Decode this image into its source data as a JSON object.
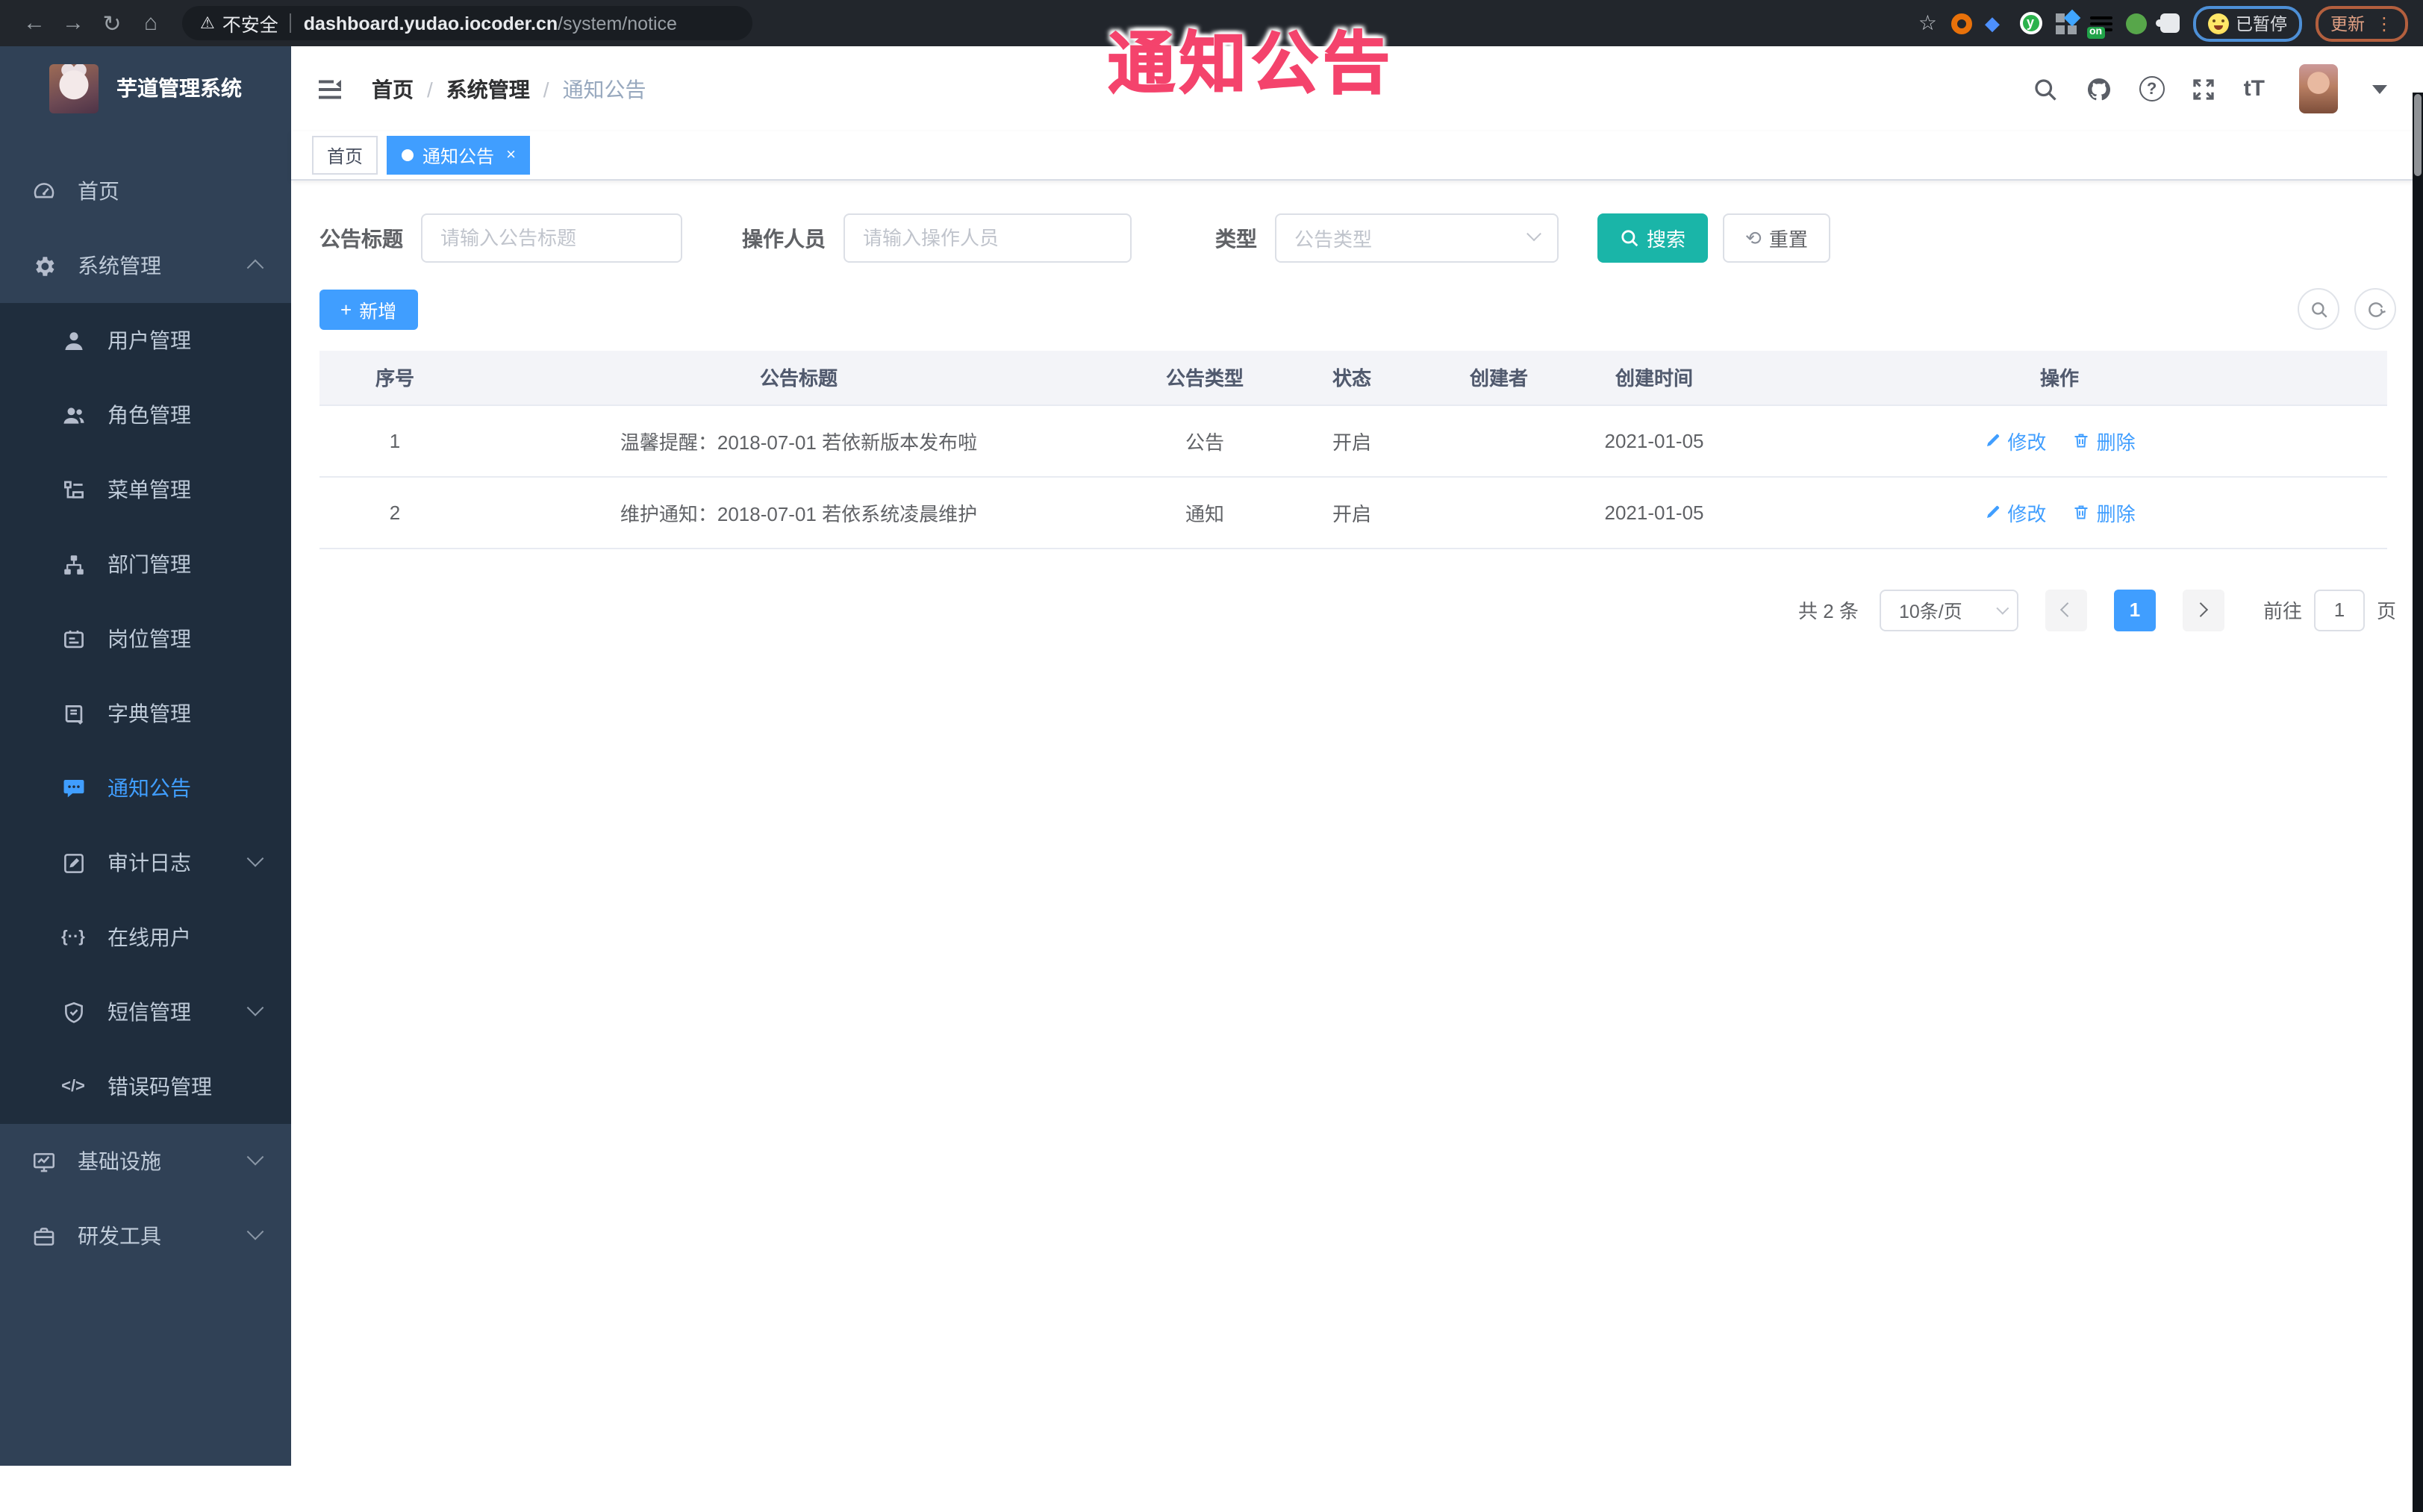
{
  "overlay": {
    "title": "通知公告"
  },
  "browser": {
    "security_label": "不安全",
    "url_host": "dashboard.yudao.iocoder.cn",
    "url_path": "/system/notice",
    "on_badge": "on",
    "paused_label": "已暂停",
    "update_label": "更新"
  },
  "sidebar": {
    "app_title": "芋道管理系统",
    "items": [
      {
        "label": "首页",
        "icon": "dashboard"
      },
      {
        "label": "系统管理",
        "icon": "gear",
        "chevron": "up"
      },
      {
        "label": "用户管理",
        "icon": "user",
        "sub": true
      },
      {
        "label": "角色管理",
        "icon": "users",
        "sub": true
      },
      {
        "label": "菜单管理",
        "icon": "menu-tree",
        "sub": true
      },
      {
        "label": "部门管理",
        "icon": "org-tree",
        "sub": true
      },
      {
        "label": "岗位管理",
        "icon": "id-badge",
        "sub": true
      },
      {
        "label": "字典管理",
        "icon": "dictionary",
        "sub": true
      },
      {
        "label": "通知公告",
        "icon": "announcement",
        "sub": true,
        "active": true
      },
      {
        "label": "审计日志",
        "icon": "audit-log",
        "sub": true,
        "chevron": "down"
      },
      {
        "label": "在线用户",
        "icon": "online-user",
        "sub": true
      },
      {
        "label": "短信管理",
        "icon": "sms-shield",
        "sub": true,
        "chevron": "down"
      },
      {
        "label": "错误码管理",
        "icon": "error-code",
        "sub": true
      },
      {
        "label": "基础设施",
        "icon": "infrastructure",
        "chevron": "down"
      },
      {
        "label": "研发工具",
        "icon": "dev-tools",
        "chevron": "down"
      }
    ]
  },
  "header": {
    "breadcrumb": [
      "首页",
      "系统管理",
      "通知公告"
    ]
  },
  "tabs": [
    {
      "label": "首页"
    },
    {
      "label": "通知公告",
      "active": true,
      "closable": true
    }
  ],
  "filters": {
    "title_label": "公告标题",
    "title_placeholder": "请输入公告标题",
    "operator_label": "操作人员",
    "operator_placeholder": "请输入操作人员",
    "type_label": "类型",
    "type_placeholder": "公告类型",
    "search_label": "搜索",
    "reset_label": "重置"
  },
  "toolbar": {
    "add_label": "新增"
  },
  "table": {
    "headers": [
      "序号",
      "公告标题",
      "公告类型",
      "状态",
      "创建者",
      "创建时间",
      "操作"
    ],
    "rows": [
      {
        "no": "1",
        "title": "温馨提醒：2018-07-01 若依新版本发布啦",
        "type": "公告",
        "status": "开启",
        "creator": "",
        "time": "2021-01-05"
      },
      {
        "no": "2",
        "title": "维护通知：2018-07-01 若依系统凌晨维护",
        "type": "通知",
        "status": "开启",
        "creator": "",
        "time": "2021-01-05"
      }
    ],
    "edit_label": "修改",
    "delete_label": "删除"
  },
  "pagination": {
    "total_text": "共 2 条",
    "page_size": "10条/页",
    "current_page": "1",
    "goto_label": "前往",
    "goto_value": "1",
    "page_suffix": "页"
  },
  "colors": {
    "primary": "#409eff",
    "search_teal": "#1ab5a8",
    "sidebar_bg": "#304156",
    "submenu_bg": "#1f2d3d",
    "overlay_pink": "#f4436c"
  }
}
